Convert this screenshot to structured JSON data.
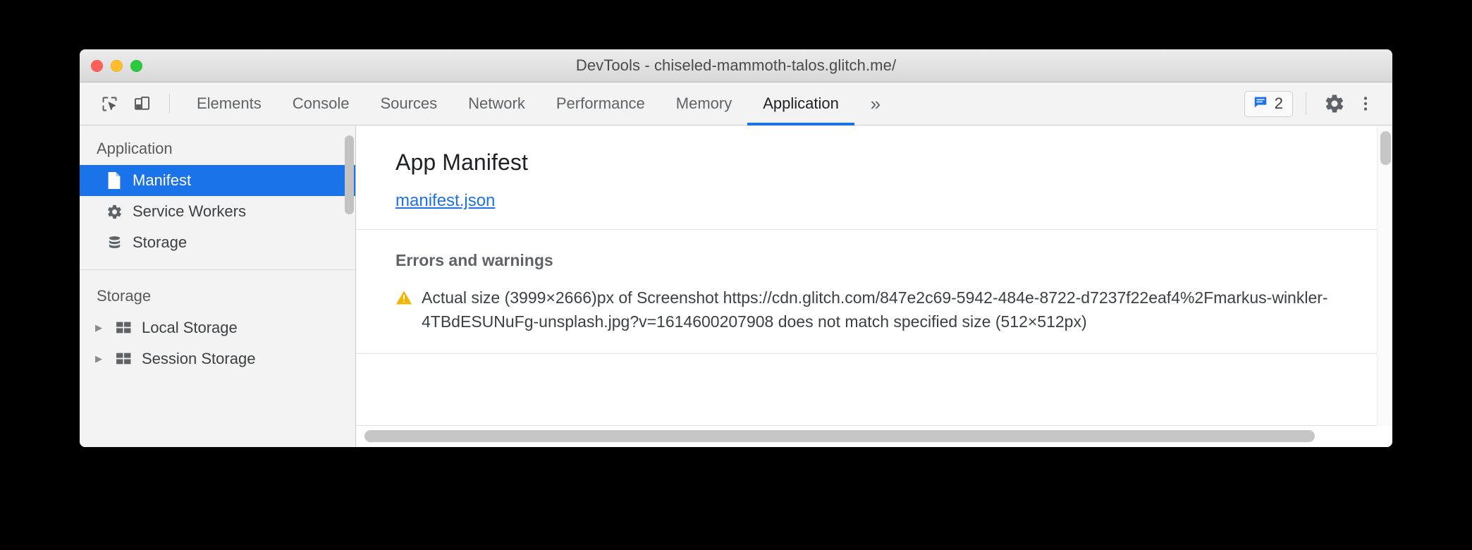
{
  "window": {
    "title": "DevTools - chiseled-mammoth-talos.glitch.me/",
    "traffic_lights": {
      "close": "close-window",
      "minimize": "minimize-window",
      "maximize": "maximize-window"
    },
    "colors": {
      "accent_blue": "#1a73e8",
      "warning_yellow": "#f2b400",
      "titlebar_gray": "#e4e4e4",
      "toolbar_gray": "#f3f3f3"
    }
  },
  "toolbar": {
    "inspect_icon": "inspect-element-icon",
    "device_icon": "device-toolbar-icon",
    "tabs": [
      {
        "label": "Elements",
        "selected": false
      },
      {
        "label": "Console",
        "selected": false
      },
      {
        "label": "Sources",
        "selected": false
      },
      {
        "label": "Network",
        "selected": false
      },
      {
        "label": "Performance",
        "selected": false
      },
      {
        "label": "Memory",
        "selected": false
      },
      {
        "label": "Application",
        "selected": true
      }
    ],
    "overflow_label": "»",
    "issues": {
      "icon": "console-message-icon",
      "count": "2"
    },
    "settings_icon": "gear-icon",
    "more_icon": "more-vertical-icon"
  },
  "sidebar": {
    "groups": [
      {
        "title": "Application",
        "items": [
          {
            "label": "Manifest",
            "icon": "document-icon",
            "selected": true,
            "expandable": false
          },
          {
            "label": "Service Workers",
            "icon": "gear-icon",
            "selected": false,
            "expandable": false
          },
          {
            "label": "Storage",
            "icon": "database-icon",
            "selected": false,
            "expandable": false
          }
        ]
      },
      {
        "title": "Storage",
        "items": [
          {
            "label": "Local Storage",
            "icon": "table-icon",
            "selected": false,
            "expandable": true
          },
          {
            "label": "Session Storage",
            "icon": "table-icon",
            "selected": false,
            "expandable": true
          }
        ]
      }
    ],
    "expand_arrow": "▶"
  },
  "main": {
    "heading": "App Manifest",
    "manifest_link": "manifest.json",
    "errors_heading": "Errors and warnings",
    "warning": {
      "icon": "warning-triangle-icon",
      "message": "Actual size (3999×2666)px of Screenshot https://cdn.glitch.com/847e2c69-5942-484e-8722-d7237f22eaf4%2Fmarkus-winkler-4TBdESUNuFg-unsplash.jpg?v=1614600207908 does not match specified size (512×512px)"
    }
  },
  "scrollbars": {
    "sidebar_vertical": "sidebar-scrollbar",
    "panel_vertical": "panel-vertical-scrollbar",
    "panel_horizontal": "panel-horizontal-scrollbar"
  }
}
